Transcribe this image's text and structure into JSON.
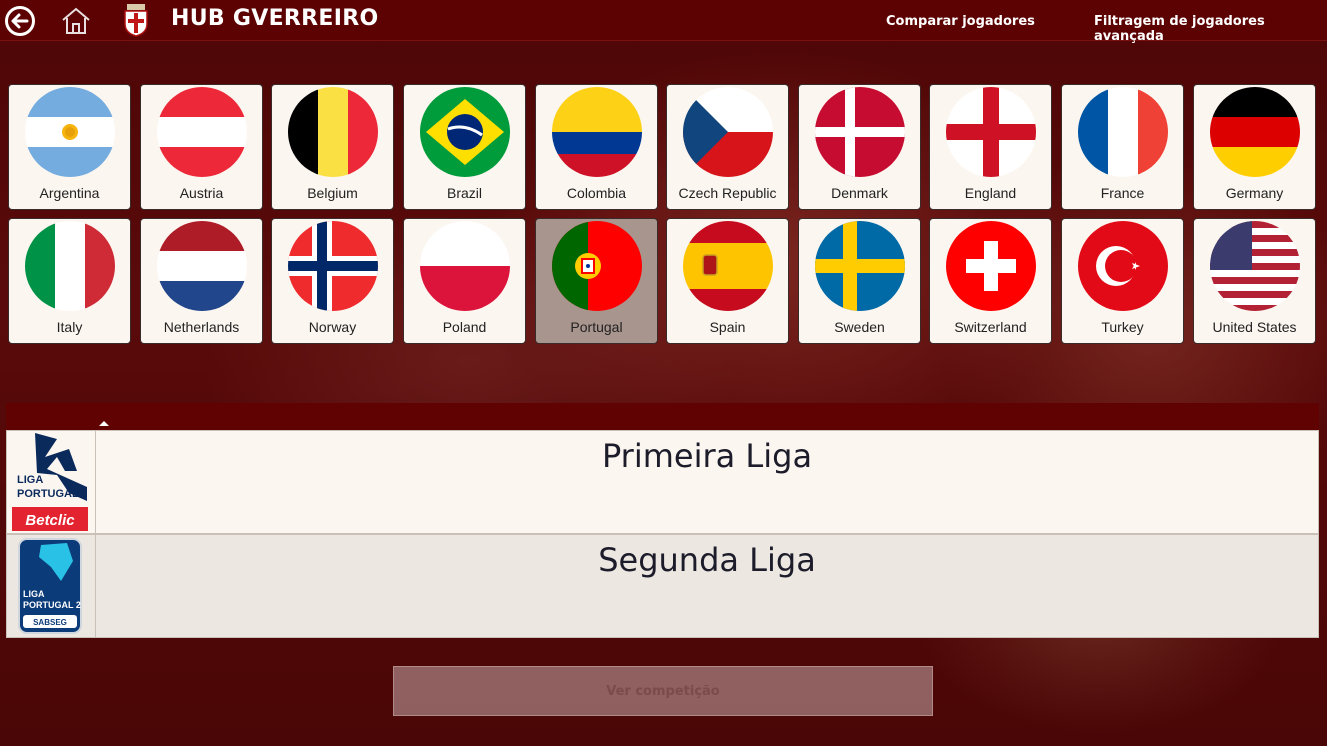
{
  "header": {
    "title": "HUB GVERREIRO",
    "back_icon": "arrow-left-circle-icon",
    "home_icon": "home-icon",
    "crest_icon": "club-crest-icon",
    "nav": {
      "compare": "Comparar jogadores",
      "advanced_filter": "Filtragem de jogadores avançada"
    }
  },
  "countries": [
    {
      "name": "Argentina"
    },
    {
      "name": "Austria"
    },
    {
      "name": "Belgium"
    },
    {
      "name": "Brazil"
    },
    {
      "name": "Colombia"
    },
    {
      "name": "Czech Republic"
    },
    {
      "name": "Denmark"
    },
    {
      "name": "England"
    },
    {
      "name": "France"
    },
    {
      "name": "Germany"
    },
    {
      "name": "Italy"
    },
    {
      "name": "Netherlands"
    },
    {
      "name": "Norway"
    },
    {
      "name": "Poland"
    },
    {
      "name": "Portugal",
      "selected": true
    },
    {
      "name": "Spain"
    },
    {
      "name": "Sweden"
    },
    {
      "name": "Switzerland"
    },
    {
      "name": "Turkey"
    },
    {
      "name": "United States"
    }
  ],
  "leagues": [
    {
      "name": "Primeira Liga",
      "logo": {
        "line1": "LIGA",
        "line2": "PORTUGAL",
        "sponsor": "Betclic"
      }
    },
    {
      "name": "Segunda Liga",
      "logo": {
        "line1": "LIGA",
        "line2": "PORTUGAL 2",
        "sponsor": "SABSEG"
      }
    }
  ],
  "actions": {
    "view_competition": "Ver competição"
  },
  "colors": {
    "topbar": "#5c0202",
    "card_bg": "#fbf6f0",
    "card_selected": "#a8958e",
    "table_header": "#600202"
  }
}
